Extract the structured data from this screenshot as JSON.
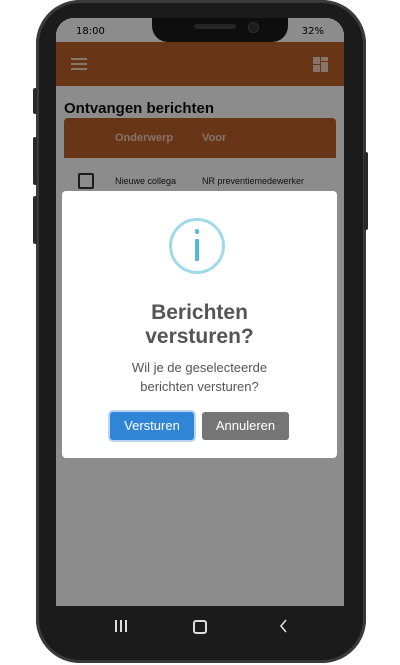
{
  "status_bar": {
    "time": "18:00",
    "battery": "32%"
  },
  "page": {
    "title": "Ontvangen berichten"
  },
  "table": {
    "headers": [
      "Onderwerp",
      "Voor"
    ],
    "rows": [
      {
        "subject": "Nieuwe collega",
        "to": "NR preventiemedewerker"
      }
    ]
  },
  "dialog": {
    "icon": "info-icon",
    "title_line1": "Berichten",
    "title_line2": "versturen?",
    "text_line1": "Wil je de geselecteerde",
    "text_line2": "berichten versturen?",
    "confirm_label": "Versturen",
    "cancel_label": "Annuleren"
  },
  "colors": {
    "app_bar": "#c0622b",
    "confirm_button": "#3085d6",
    "cancel_button": "#757575",
    "info_icon": "#53b8e0"
  }
}
